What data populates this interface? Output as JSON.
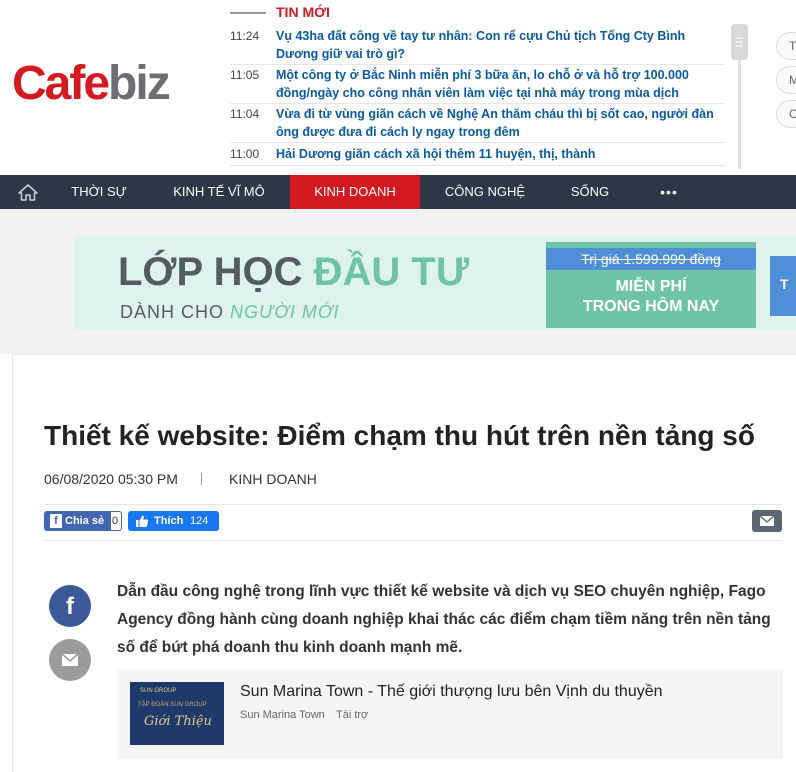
{
  "header": {
    "logo": {
      "cafe": "Cafe",
      "biz": "biz"
    },
    "news_label": "TIN MỚI",
    "news": [
      {
        "time": "11:24",
        "title": "Vụ 43ha đất công về tay tư nhân: Con rể cựu Chủ tịch Tổng Cty Bình Dương giữ vai trò gì?"
      },
      {
        "time": "11:05",
        "title": "Một công ty ở Bắc Ninh miễn phí 3 bữa ăn, lo chỗ ở và hỗ trợ 100.000 đồng/ngày cho công nhân viên làm việc tại nhà máy trong mùa dịch"
      },
      {
        "time": "11:04",
        "title": "Vừa đi từ vùng giãn cách về Nghệ An thăm cháu thì bị sốt cao, người đàn ông được đưa đi cách ly ngay trong đêm"
      },
      {
        "time": "11:00",
        "title": "Hải Dương giãn cách xã hội thêm 11 huyện, thị, thành"
      }
    ],
    "side_pills": [
      "T",
      "M",
      "C"
    ]
  },
  "nav": {
    "items": [
      "THỜI SỰ",
      "KINH TẾ VĨ MÔ",
      "KINH DOANH",
      "CÔNG NGHỆ",
      "SỐNG",
      "•••"
    ],
    "active": "KINH DOANH"
  },
  "banner": {
    "line1a": "LỚP HỌC ",
    "line1b": "ĐẦU TƯ",
    "line2a": "DÀNH CHO ",
    "line2b": "NGƯỜI MỚI",
    "price": "Trị giá 1.599.999 đồng",
    "free1": "MIỄN PHÍ",
    "free2": "TRONG HÔM NAY",
    "edge": "T"
  },
  "article": {
    "title": "Thiết kế website: Điểm chạm thu hút trên nền tảng số",
    "date": "06/08/2020 05:30 PM",
    "category": "KINH DOANH",
    "share_label": "Chia sẻ",
    "share_count": "0",
    "like_label": "Thích",
    "like_count": "124",
    "sapo": "Dẫn đầu công nghệ trong lĩnh vực thiết kế website và dịch vụ SEO chuyên nghiệp, Fago Agency đồng hành cùng doanh nghiệp khai thác các điểm chạm tiềm năng trên nền tảng số để bứt phá doanh thu kinh doanh mạnh mẽ."
  },
  "ad": {
    "title": "Sun Marina Town - Thế giới thượng lưu bên Vịnh du thuyền",
    "source": "Sun Marina Town",
    "sponsor": "Tài trợ",
    "thumb_logo": "SUN GROUP",
    "thumb_line1": "TẬP ĐOÀN SUN GROUP",
    "thumb_line2": "Giới Thiệu"
  },
  "colors": {
    "brand_red": "#d41920",
    "nav_bg": "#2c3848",
    "link_blue": "#0a5aa5",
    "facebook": "#3b5998"
  },
  "icons": [
    "home-icon",
    "facebook-icon",
    "mail-icon",
    "thumbs-up-icon"
  ]
}
